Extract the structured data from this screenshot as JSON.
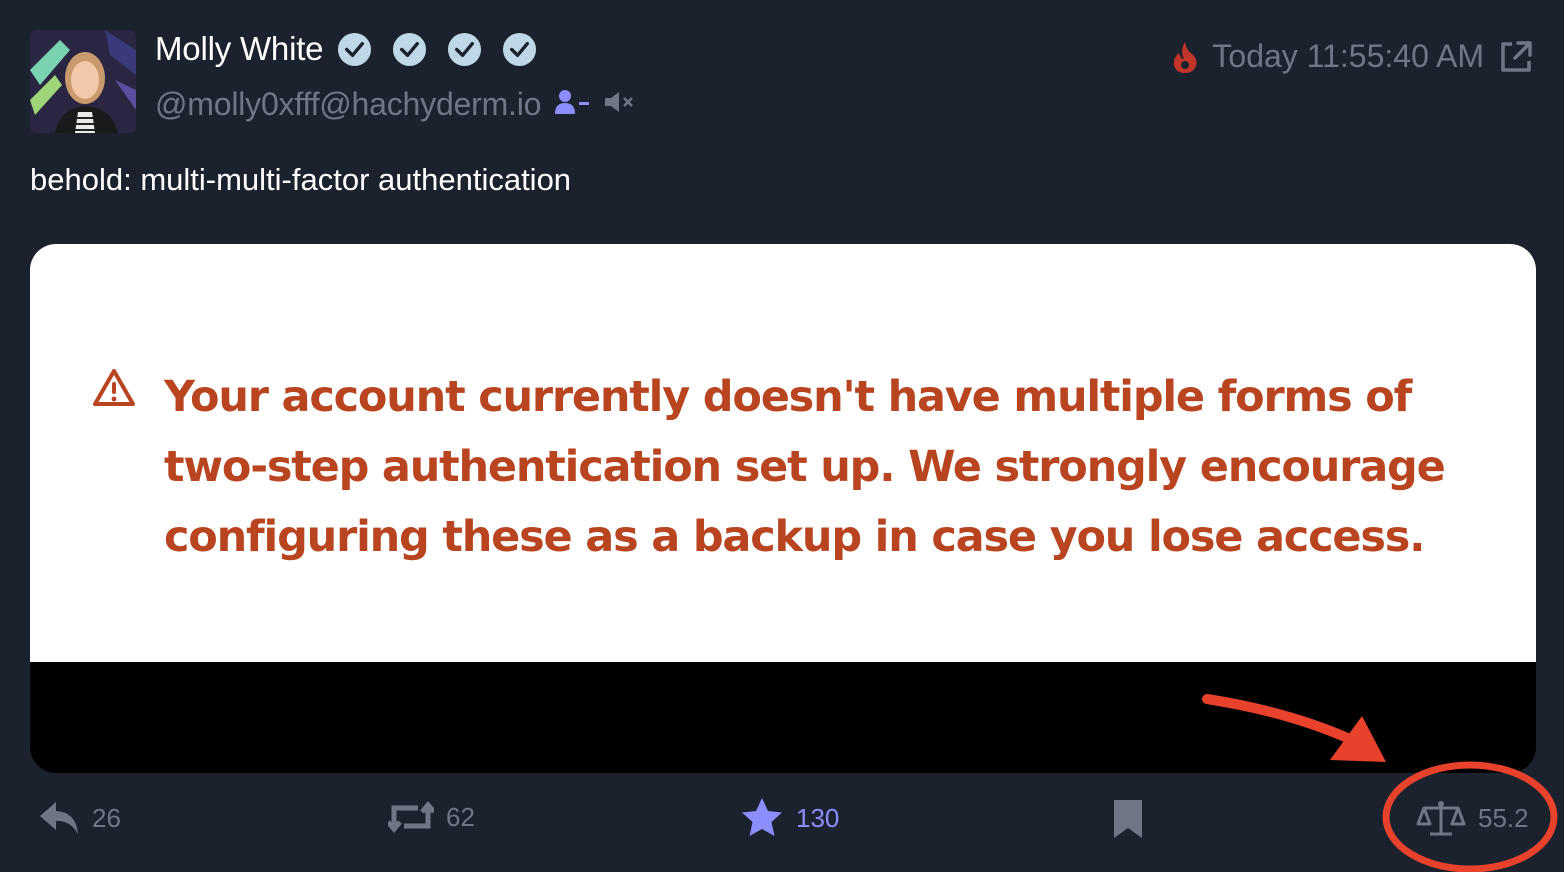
{
  "post": {
    "author": {
      "display_name": "Molly White",
      "handle": "@molly0xfff@hachyderm.io",
      "verified_badges": 4
    },
    "timestamp": "Today 11:55:40 AM",
    "text": "behold: multi-multi-factor authentication",
    "media": {
      "alert_text": "Your account currently doesn't have multiple forms of two-step authentication set up. We strongly encourage configuring these as a backup in case you lose access."
    },
    "actions": {
      "replies": "26",
      "boosts": "62",
      "favourites": "130",
      "score": "55.2"
    }
  },
  "colors": {
    "background": "#1c222d",
    "muted": "#6f7787",
    "accent": "#8c8dff",
    "alert": "#b94520",
    "annotation": "#e8422d",
    "hot": "#c2352a"
  },
  "icons": [
    "verified-badge-icon",
    "unfollow-icon",
    "mute-icon",
    "flame-icon",
    "external-link-icon",
    "warning-icon",
    "reply-icon",
    "boost-icon",
    "star-icon",
    "bookmark-icon",
    "scale-icon"
  ]
}
